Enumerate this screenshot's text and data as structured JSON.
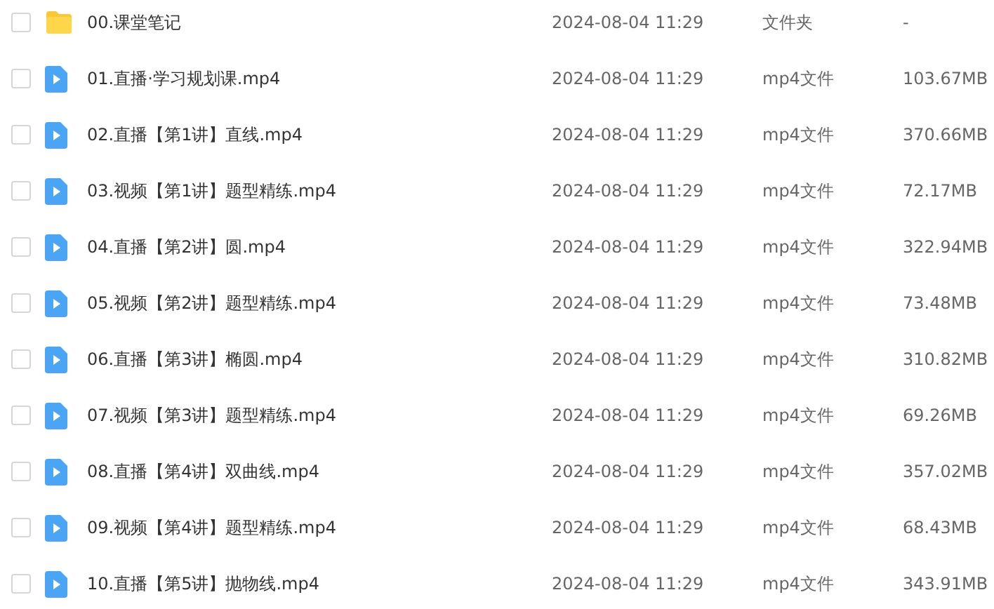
{
  "files": [
    {
      "kind": "folder",
      "checked": false,
      "name": "00.课堂笔记",
      "modified": "2024-08-04 11:29",
      "type": "文件夹",
      "size": "-"
    },
    {
      "kind": "video",
      "checked": false,
      "name": "01.直播·学习规划课.mp4",
      "modified": "2024-08-04 11:29",
      "type": "mp4文件",
      "size": "103.67MB"
    },
    {
      "kind": "video",
      "checked": false,
      "name": "02.直播【第1讲】直线.mp4",
      "modified": "2024-08-04 11:29",
      "type": "mp4文件",
      "size": "370.66MB"
    },
    {
      "kind": "video",
      "checked": false,
      "name": "03.视频【第1讲】题型精练.mp4",
      "modified": "2024-08-04 11:29",
      "type": "mp4文件",
      "size": "72.17MB"
    },
    {
      "kind": "video",
      "checked": false,
      "name": "04.直播【第2讲】圆.mp4",
      "modified": "2024-08-04 11:29",
      "type": "mp4文件",
      "size": "322.94MB"
    },
    {
      "kind": "video",
      "checked": false,
      "name": "05.视频【第2讲】题型精练.mp4",
      "modified": "2024-08-04 11:29",
      "type": "mp4文件",
      "size": "73.48MB"
    },
    {
      "kind": "video",
      "checked": false,
      "name": "06.直播【第3讲】椭圆.mp4",
      "modified": "2024-08-04 11:29",
      "type": "mp4文件",
      "size": "310.82MB"
    },
    {
      "kind": "video",
      "checked": false,
      "name": "07.视频【第3讲】题型精练.mp4",
      "modified": "2024-08-04 11:29",
      "type": "mp4文件",
      "size": "69.26MB"
    },
    {
      "kind": "video",
      "checked": false,
      "name": "08.直播【第4讲】双曲线.mp4",
      "modified": "2024-08-04 11:29",
      "type": "mp4文件",
      "size": "357.02MB"
    },
    {
      "kind": "video",
      "checked": false,
      "name": "09.视频【第4讲】题型精练.mp4",
      "modified": "2024-08-04 11:29",
      "type": "mp4文件",
      "size": "68.43MB"
    },
    {
      "kind": "video",
      "checked": false,
      "name": "10.直播【第5讲】抛物线.mp4",
      "modified": "2024-08-04 11:29",
      "type": "mp4文件",
      "size": "343.91MB"
    }
  ]
}
